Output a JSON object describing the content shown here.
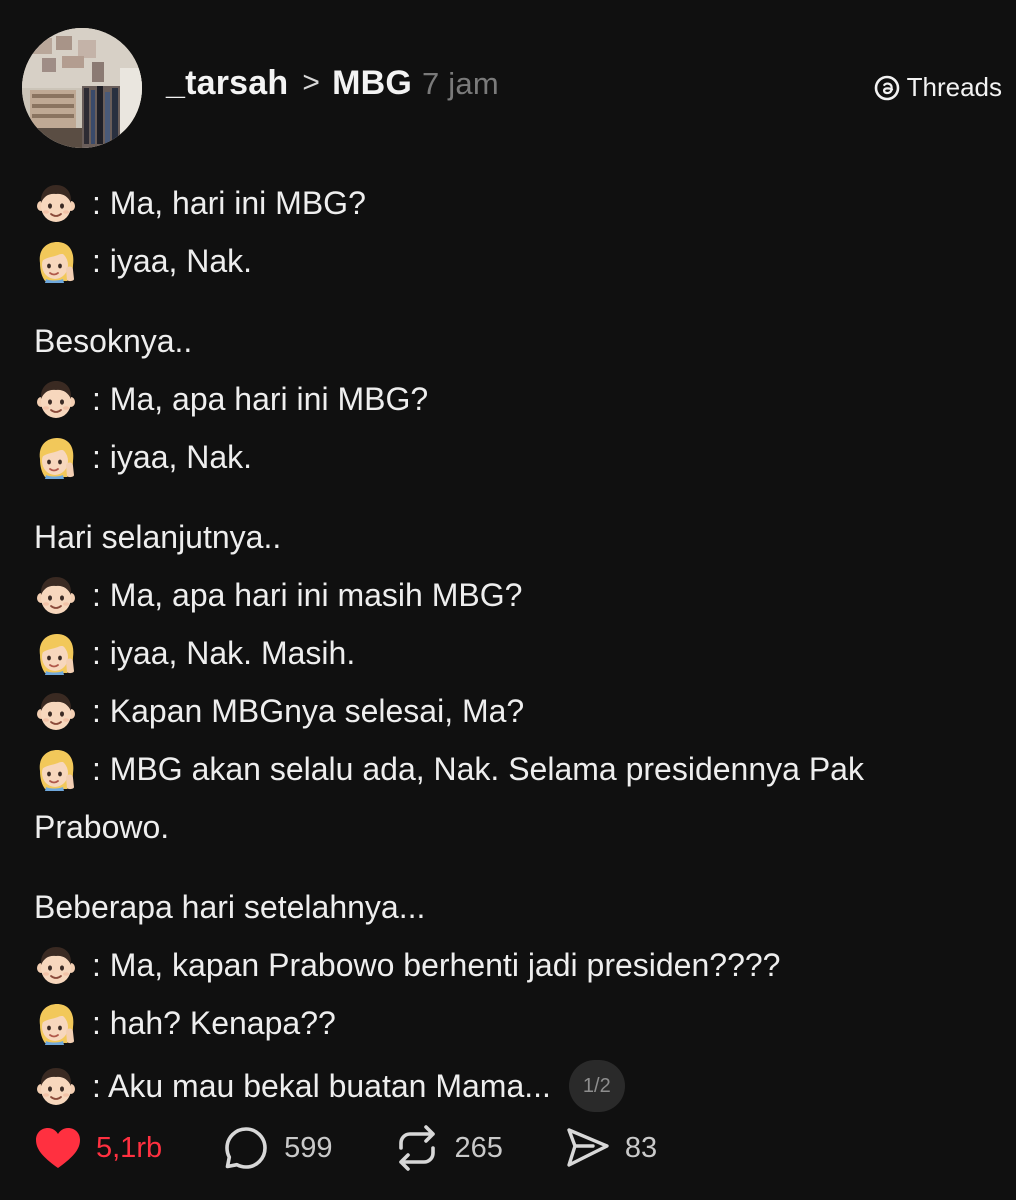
{
  "header": {
    "username": "_tarsah",
    "separator": ">",
    "topic": "MBG",
    "time": "7 jam",
    "brand": "Threads",
    "brand_icon": "threads-logo-icon"
  },
  "emoji": {
    "boy": "boy-emoji",
    "mom": "blond-woman-emoji"
  },
  "post": {
    "l1": ": Ma, hari ini MBG?",
    "l2": ": iyaa, Nak.",
    "l3": "Besoknya..",
    "l4": ": Ma, apa hari ini MBG?",
    "l5": ": iyaa, Nak.",
    "l6": "Hari selanjutnya..",
    "l7": ": Ma, apa hari ini masih MBG?",
    "l8": ": iyaa, Nak. Masih.",
    "l9": ": Kapan MBGnya selesai, Ma?",
    "l10": ": MBG akan selalu ada, Nak. Selama presidennya Pak Prabowo.",
    "l11": "Beberapa hari setelahnya...",
    "l12": ": Ma, kapan Prabowo berhenti jadi presiden????",
    "l13": ": hah? Kenapa??",
    "l14": ": Aku mau bekal buatan Mama...",
    "page_indicator": "1/2"
  },
  "actions": {
    "likes": "5,1rb",
    "replies": "599",
    "reposts": "265",
    "shares": "83"
  },
  "colors": {
    "background": "#101010",
    "like": "#ff3040",
    "muted": "#7a7a7a"
  }
}
